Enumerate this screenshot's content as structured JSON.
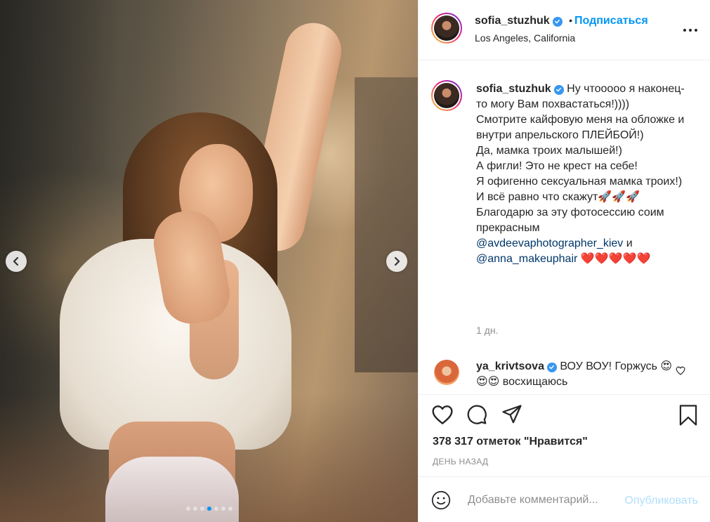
{
  "post": {
    "dots_count": 7,
    "active_dot_index": 3
  },
  "header": {
    "username": "sofia_stuzhuk",
    "separator": "•",
    "follow_label": "Подписаться",
    "location": "Los Angeles, California"
  },
  "caption": {
    "username": "sofia_stuzhuk",
    "text": "Ну чтооооо я наконец-то могу Вам похвастаться!))))\nСмотрите кайфовую меня на обложке и внутри апрельского ПЛЕЙБОЙ!)\nДа, мамка троих малышей!)\nА фигли! Это не крест на себе!\nЯ офигенно сексуальная мамка троих!)\nИ всё равно что скажут🚀🚀🚀\nБлагодарю за эту фотосессию соим прекрасным\n",
    "mention1": "@avdeevaphotographer_kiev",
    "joiner": " и",
    "mention2": "@anna_makeuphair",
    "hearts": " ❤️❤️❤️❤️❤️",
    "time": "1 дн."
  },
  "comment": {
    "username": "ya_krivtsova",
    "text": " ВОУ ВОУ! Горжусь 😍😍😍 восхищаюсь"
  },
  "likes_text": "378 317 отметок \"Нравится\"",
  "posted_when": "ДЕНЬ НАЗАД",
  "add_comment": {
    "placeholder": "Добавьте комментарий...",
    "publish_label": "Опубликовать"
  },
  "colors": {
    "link_blue": "#0095f6",
    "publish_disabled": "#b2dffc",
    "verified_blue": "#3897f0",
    "muted_text": "#8e8e8e"
  }
}
